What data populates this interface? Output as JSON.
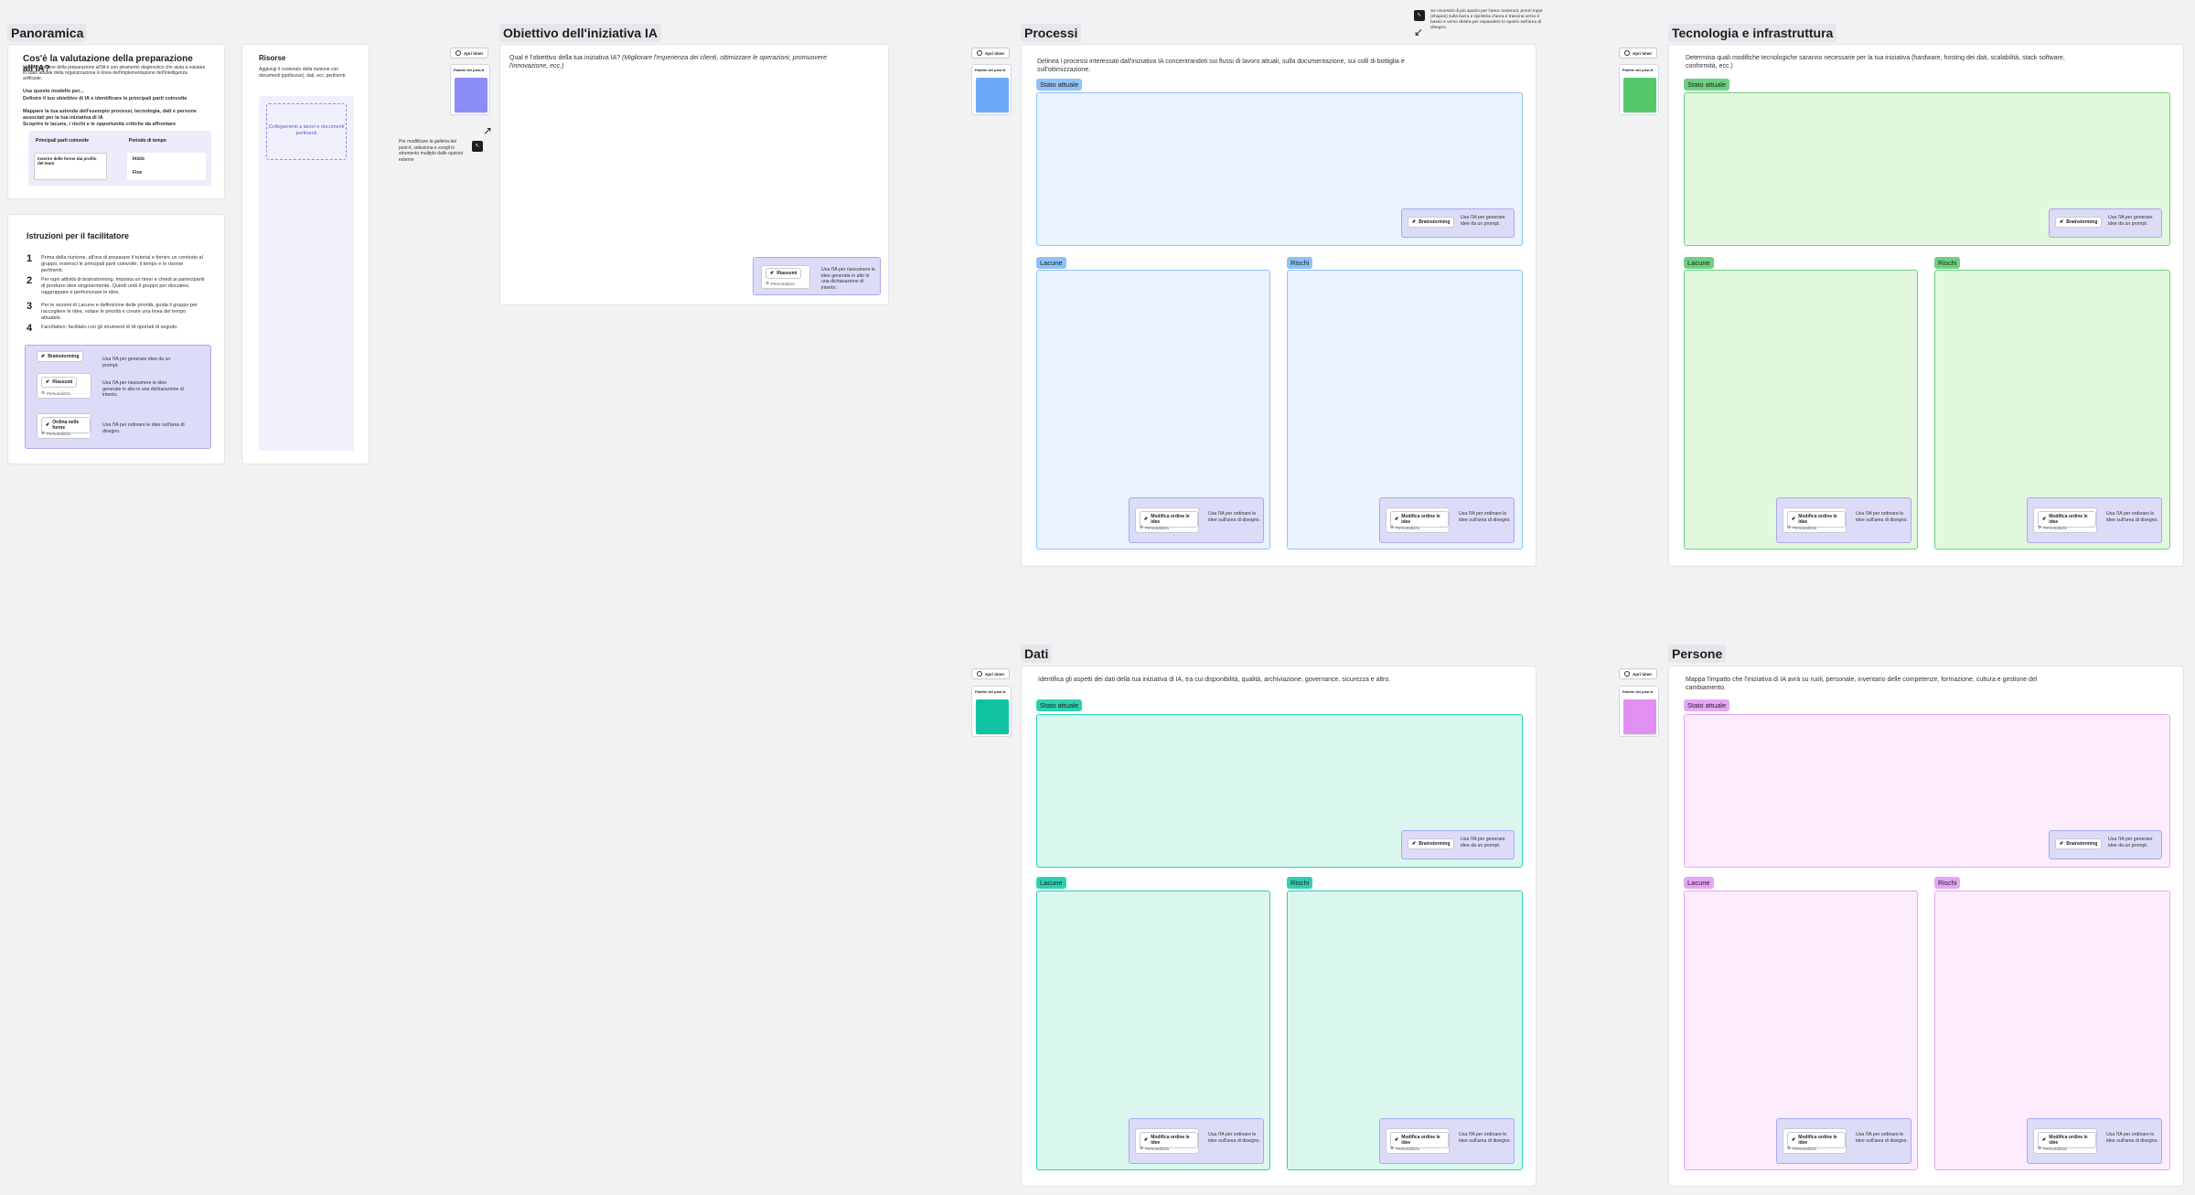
{
  "overview": {
    "title": "Panoramica",
    "heading": "Cos'è la valutazione della preparazione all'IA?",
    "intro": "Una valutazione della preparazione all'IA è uno strumento diagnostico che aiuta a valutare lo stato attuale della organizzazione in linea dell'implementazione dell'intelligenza artificiale.",
    "use_title": "Usa questo modello per...",
    "use_items": [
      "Definire il tuo obiettivo di IA e identificare le principali parti coinvolte",
      "Mappare la tua azienda dell'esempio processi, tecnologia, dati e persone associati per la tua iniziativa di IA",
      "Scoprire le lacune, i rischi e le opportunità critiche da affrontare"
    ],
    "table": {
      "col1": "Principali parti coinvolte",
      "col2": "Periodo di tempo",
      "row1": "Inserire delle forme dai profilo del team",
      "start": "Inizio",
      "end": "Fine"
    }
  },
  "facilitator": {
    "title": "Istruzioni per il facilitatore",
    "steps": [
      {
        "num": "1",
        "text": "Prima della riunione, all'ora di preparare il tutorial e fornire un contesto al gruppo, inserisci le principali parti coinvolte, il tempo e le risorse pertinenti."
      },
      {
        "num": "2",
        "text": "Per ogni attività di brainstorming, imposta un timer e chiedi ai partecipanti di produrre idee singolarmente. Quindi uniti il gruppo per discutere, raggruppare e perfezionare le idee."
      },
      {
        "num": "3",
        "text": "Per le sezioni di Lacune e definizione delle priorità, guida il gruppo per raccogliere le idee, votare le priorità e creare una linea del tempo attuabile."
      },
      {
        "num": "4",
        "text": "Facoltativo: facilitalo con gli strumenti di IA riportati di seguito."
      }
    ],
    "ai_tools": [
      {
        "btn": "Brainstorming",
        "sub": "",
        "desc": "Usa l'IA per generare idee da un prompt."
      },
      {
        "btn": "Riassumi",
        "sub": "Personalizza",
        "desc": "Usa l'IA per riassumere le idee generate in alto in una dichiarazione di intento."
      },
      {
        "btn": "Ordina nelle forme",
        "sub": "Personalizza",
        "desc": "Usa l'IA per ordinare le idee sull'area di disegno."
      }
    ]
  },
  "resources": {
    "title": "Risorse",
    "desc": "Aggiungi il contenuto della riunione con documenti (ppt/bozze), dati, ecc. pertinenti.",
    "placeholder": "Collegamenti a lavori e documenti pertinenti"
  },
  "common": {
    "open_label": "Apri timer",
    "palette_label": "Palette dei post-it",
    "current": "Stato attuale",
    "gaps": "Lacune",
    "risks": "Rischi",
    "brainstorm": "Brainstorming",
    "brainstorm_desc": "Usa l'IA per generare idee da un prompt.",
    "sort": "Modifica ordine le idee",
    "sort_sub": "Personalizza",
    "sort_desc": "Usa l'IA per ordinare le idee sull'area di disegno."
  },
  "objective": {
    "title": "Obiettivo dell'iniziativa IA",
    "question_main": "Qual è l'obiettivo della tua iniziativa IA?",
    "question_hint": "(Migliorare l'esperienza dei clienti, ottimizzare le operazioni, promuovere l'innovazione, ecc.)",
    "note": "Per modificare la galleria dei post-it, seleziona e scegli lo strumento multiplo dalle opzioni esterne",
    "ai_btn": "Riassumi",
    "ai_sub": "Personalizza",
    "ai_desc": "Usa l'IA per riassumere le idee generate in alto in una dichiarazione di intento."
  },
  "top_note": "Se necessiti di più spazio per l'area contenuti, premi Input (shapes) sulla barra e ripristina d'area e trascina verso il basso e verso destra per espandere lo spazio sull'area di disegno.",
  "processes": {
    "title": "Processi",
    "desc": "Delinea i processi interessati dall'iniziativa IA concentrandoti sui flussi di lavoro attuali, sulla documentazione, sui colli di bottiglia e sull'ottimizzazione."
  },
  "technology": {
    "title": "Tecnologia e infrastruttura",
    "desc": "Determina quali modifiche tecnologiche saranno necessarie per la tua iniziativa (hardware, hosting dei dati, scalabilità, stack software, conformità, ecc.)"
  },
  "data_sec": {
    "title": "Dati",
    "desc": "Identifica gli aspetti dei dati della tua iniziativa di IA, tra cui disponibilità, qualità, archiviazione, governance, sicurezza e altro."
  },
  "people": {
    "title": "Persone",
    "desc": "Mappa l'impatto che l'iniziativa di IA avrà su ruoli, personale, inventario delle competenze, formazione, cultura e gestione del cambiamento."
  },
  "colors": {
    "purple_sticky": "#8c8cf7",
    "blue_sticky": "#6aa9f8",
    "green_sticky": "#55c86c",
    "teal_sticky": "#10c2a0",
    "pink_sticky": "#df90f2"
  }
}
